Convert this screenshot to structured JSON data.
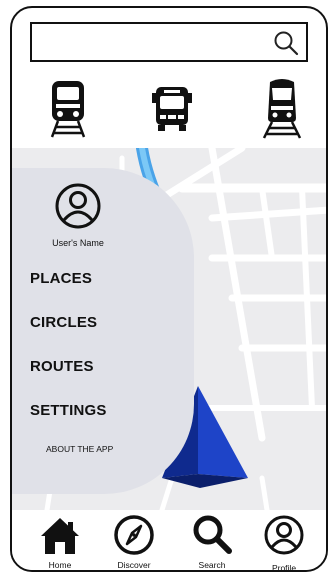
{
  "search": {
    "value": "",
    "placeholder": "",
    "icon": "search-icon"
  },
  "transit": [
    {
      "name": "train",
      "icon": "train-icon"
    },
    {
      "name": "bus",
      "icon": "bus-icon"
    },
    {
      "name": "metro",
      "icon": "high-speed-train-icon"
    }
  ],
  "menu": {
    "user_name": "User's Name",
    "items": [
      {
        "label": "PLACES"
      },
      {
        "label": "CIRCLES"
      },
      {
        "label": "ROUTES"
      },
      {
        "label": "SETTINGS"
      }
    ],
    "about_label": "ABOUT THE APP"
  },
  "nav": [
    {
      "label": "Home",
      "icon": "home-icon"
    },
    {
      "label": "Discover",
      "icon": "compass-icon"
    },
    {
      "label": "Search",
      "icon": "search-icon"
    },
    {
      "label": "Profile",
      "icon": "user-icon"
    }
  ],
  "colors": {
    "route": "#5ab6f0",
    "arrow": "#1e44c8",
    "menu_bg": "#e0e1e8",
    "map_bg": "#ececee"
  }
}
